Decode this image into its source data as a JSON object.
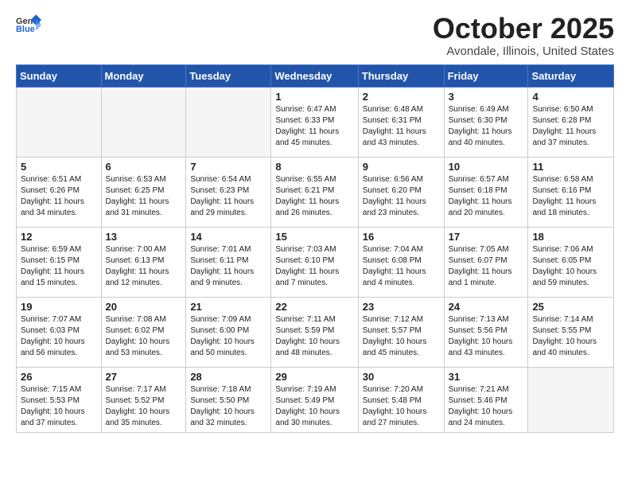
{
  "header": {
    "logo_general": "General",
    "logo_blue": "Blue",
    "title": "October 2025",
    "subtitle": "Avondale, Illinois, United States"
  },
  "weekdays": [
    "Sunday",
    "Monday",
    "Tuesday",
    "Wednesday",
    "Thursday",
    "Friday",
    "Saturday"
  ],
  "weeks": [
    [
      {
        "day": "",
        "info": ""
      },
      {
        "day": "",
        "info": ""
      },
      {
        "day": "",
        "info": ""
      },
      {
        "day": "1",
        "info": "Sunrise: 6:47 AM\nSunset: 6:33 PM\nDaylight: 11 hours\nand 45 minutes."
      },
      {
        "day": "2",
        "info": "Sunrise: 6:48 AM\nSunset: 6:31 PM\nDaylight: 11 hours\nand 43 minutes."
      },
      {
        "day": "3",
        "info": "Sunrise: 6:49 AM\nSunset: 6:30 PM\nDaylight: 11 hours\nand 40 minutes."
      },
      {
        "day": "4",
        "info": "Sunrise: 6:50 AM\nSunset: 6:28 PM\nDaylight: 11 hours\nand 37 minutes."
      }
    ],
    [
      {
        "day": "5",
        "info": "Sunrise: 6:51 AM\nSunset: 6:26 PM\nDaylight: 11 hours\nand 34 minutes."
      },
      {
        "day": "6",
        "info": "Sunrise: 6:53 AM\nSunset: 6:25 PM\nDaylight: 11 hours\nand 31 minutes."
      },
      {
        "day": "7",
        "info": "Sunrise: 6:54 AM\nSunset: 6:23 PM\nDaylight: 11 hours\nand 29 minutes."
      },
      {
        "day": "8",
        "info": "Sunrise: 6:55 AM\nSunset: 6:21 PM\nDaylight: 11 hours\nand 26 minutes."
      },
      {
        "day": "9",
        "info": "Sunrise: 6:56 AM\nSunset: 6:20 PM\nDaylight: 11 hours\nand 23 minutes."
      },
      {
        "day": "10",
        "info": "Sunrise: 6:57 AM\nSunset: 6:18 PM\nDaylight: 11 hours\nand 20 minutes."
      },
      {
        "day": "11",
        "info": "Sunrise: 6:58 AM\nSunset: 6:16 PM\nDaylight: 11 hours\nand 18 minutes."
      }
    ],
    [
      {
        "day": "12",
        "info": "Sunrise: 6:59 AM\nSunset: 6:15 PM\nDaylight: 11 hours\nand 15 minutes."
      },
      {
        "day": "13",
        "info": "Sunrise: 7:00 AM\nSunset: 6:13 PM\nDaylight: 11 hours\nand 12 minutes."
      },
      {
        "day": "14",
        "info": "Sunrise: 7:01 AM\nSunset: 6:11 PM\nDaylight: 11 hours\nand 9 minutes."
      },
      {
        "day": "15",
        "info": "Sunrise: 7:03 AM\nSunset: 6:10 PM\nDaylight: 11 hours\nand 7 minutes."
      },
      {
        "day": "16",
        "info": "Sunrise: 7:04 AM\nSunset: 6:08 PM\nDaylight: 11 hours\nand 4 minutes."
      },
      {
        "day": "17",
        "info": "Sunrise: 7:05 AM\nSunset: 6:07 PM\nDaylight: 11 hours\nand 1 minute."
      },
      {
        "day": "18",
        "info": "Sunrise: 7:06 AM\nSunset: 6:05 PM\nDaylight: 10 hours\nand 59 minutes."
      }
    ],
    [
      {
        "day": "19",
        "info": "Sunrise: 7:07 AM\nSunset: 6:03 PM\nDaylight: 10 hours\nand 56 minutes."
      },
      {
        "day": "20",
        "info": "Sunrise: 7:08 AM\nSunset: 6:02 PM\nDaylight: 10 hours\nand 53 minutes."
      },
      {
        "day": "21",
        "info": "Sunrise: 7:09 AM\nSunset: 6:00 PM\nDaylight: 10 hours\nand 50 minutes."
      },
      {
        "day": "22",
        "info": "Sunrise: 7:11 AM\nSunset: 5:59 PM\nDaylight: 10 hours\nand 48 minutes."
      },
      {
        "day": "23",
        "info": "Sunrise: 7:12 AM\nSunset: 5:57 PM\nDaylight: 10 hours\nand 45 minutes."
      },
      {
        "day": "24",
        "info": "Sunrise: 7:13 AM\nSunset: 5:56 PM\nDaylight: 10 hours\nand 43 minutes."
      },
      {
        "day": "25",
        "info": "Sunrise: 7:14 AM\nSunset: 5:55 PM\nDaylight: 10 hours\nand 40 minutes."
      }
    ],
    [
      {
        "day": "26",
        "info": "Sunrise: 7:15 AM\nSunset: 5:53 PM\nDaylight: 10 hours\nand 37 minutes."
      },
      {
        "day": "27",
        "info": "Sunrise: 7:17 AM\nSunset: 5:52 PM\nDaylight: 10 hours\nand 35 minutes."
      },
      {
        "day": "28",
        "info": "Sunrise: 7:18 AM\nSunset: 5:50 PM\nDaylight: 10 hours\nand 32 minutes."
      },
      {
        "day": "29",
        "info": "Sunrise: 7:19 AM\nSunset: 5:49 PM\nDaylight: 10 hours\nand 30 minutes."
      },
      {
        "day": "30",
        "info": "Sunrise: 7:20 AM\nSunset: 5:48 PM\nDaylight: 10 hours\nand 27 minutes."
      },
      {
        "day": "31",
        "info": "Sunrise: 7:21 AM\nSunset: 5:46 PM\nDaylight: 10 hours\nand 24 minutes."
      },
      {
        "day": "",
        "info": ""
      }
    ]
  ]
}
